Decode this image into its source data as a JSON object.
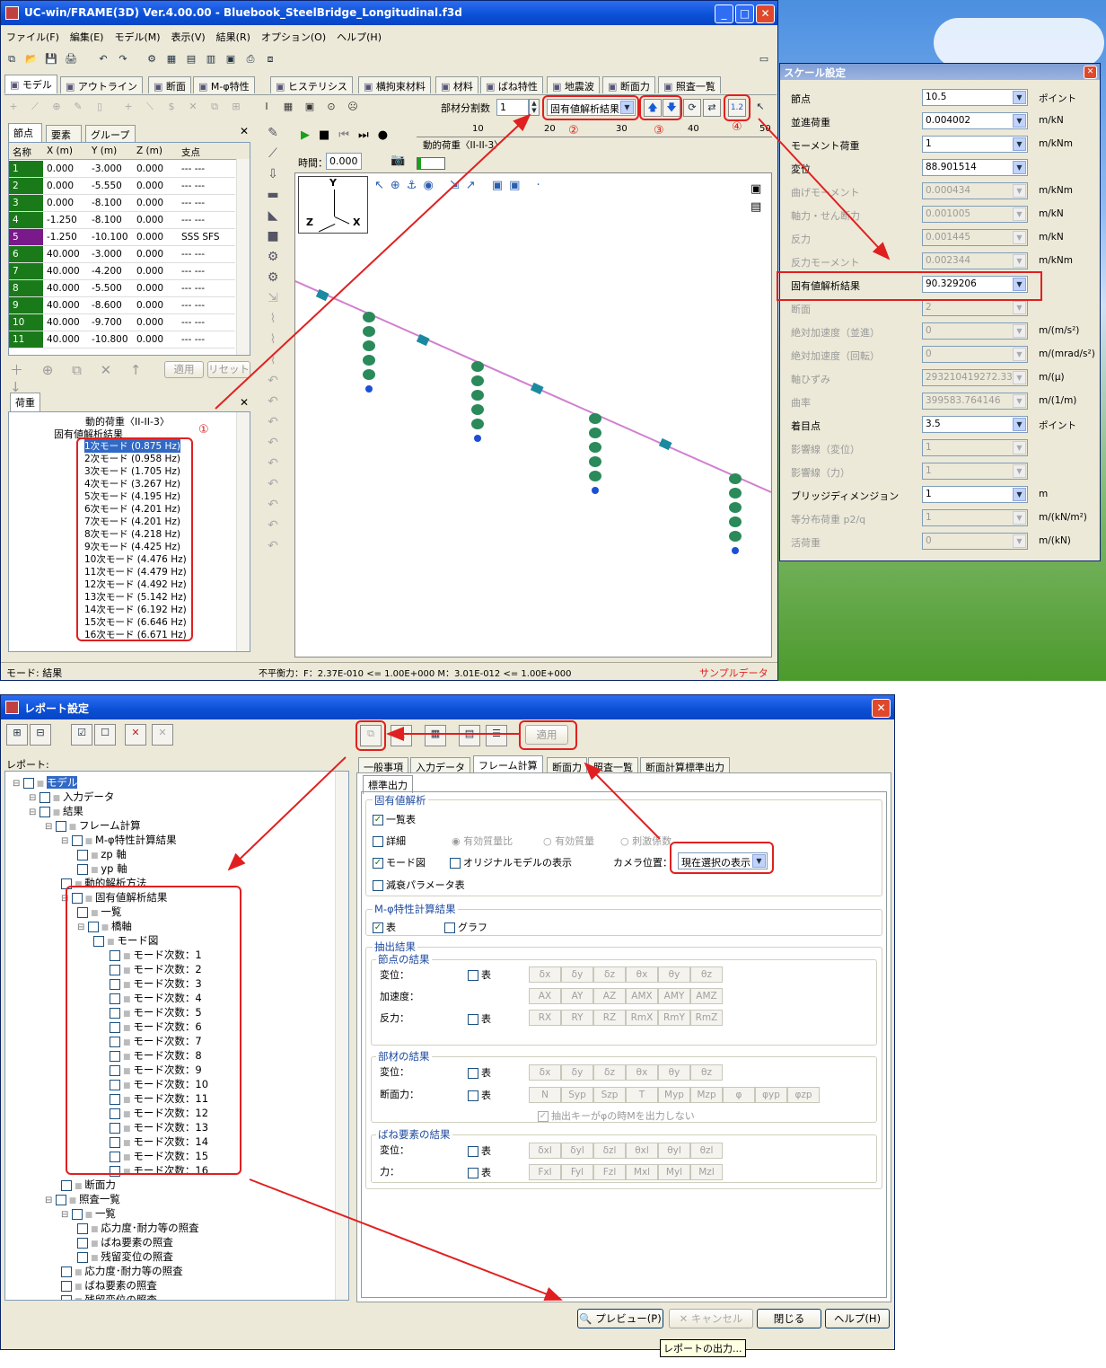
{
  "main_window": {
    "title": "UC-win/FRAME(3D) Ver.4.00.00 - Bluebook_SteelBridge_Longitudinal.f3d",
    "menu": [
      "ファイル(F)",
      "編集(E)",
      "モデル(M)",
      "表示(V)",
      "結果(R)",
      "オプション(O)",
      "ヘルプ(H)"
    ],
    "tabs": [
      "モデル",
      "アウトライン",
      "断面",
      "M-φ特性",
      "ヒステリシス",
      "横拘束材料",
      "材料",
      "ばね特性",
      "地震波",
      "断面力",
      "照査一覧"
    ],
    "segment_label": "部材分割数",
    "segment_value": "1",
    "result_combo": "固有値解析結果",
    "markers": [
      "①",
      "②",
      "③",
      "④"
    ],
    "ruler": [
      "10",
      "20",
      "30",
      "40",
      "50"
    ],
    "dynamic_load": "動的荷重〈II-II-3〉",
    "time_label": "時間：",
    "time_value": "0.000",
    "status": {
      "mode": "モード: 結果",
      "balance": "不平衡力：F：2.37E-010 <= 1.00E+000  M：3.01E-012 <= 1.00E+000",
      "sample": "サンプルデータ"
    }
  },
  "node_grid": {
    "tabs": [
      "節点",
      "要素",
      "グループ"
    ],
    "headers": [
      "名称",
      "X (m)",
      "Y (m)",
      "Z (m)",
      "支点"
    ],
    "rows": [
      [
        "1",
        "0.000",
        "-3.000",
        "0.000",
        "--- ---"
      ],
      [
        "2",
        "0.000",
        "-5.550",
        "0.000",
        "--- ---"
      ],
      [
        "3",
        "0.000",
        "-8.100",
        "0.000",
        "--- ---"
      ],
      [
        "4",
        "-1.250",
        "-8.100",
        "0.000",
        "--- ---"
      ],
      [
        "5",
        "-1.250",
        "-10.100",
        "0.000",
        "SSS SFS"
      ],
      [
        "6",
        "40.000",
        "-3.000",
        "0.000",
        "--- ---"
      ],
      [
        "7",
        "40.000",
        "-4.200",
        "0.000",
        "--- ---"
      ],
      [
        "8",
        "40.000",
        "-5.500",
        "0.000",
        "--- ---"
      ],
      [
        "9",
        "40.000",
        "-8.600",
        "0.000",
        "--- ---"
      ],
      [
        "10",
        "40.000",
        "-9.700",
        "0.000",
        "--- ---"
      ],
      [
        "11",
        "40.000",
        "-10.800",
        "0.000",
        "--- ---"
      ]
    ],
    "apply": "適用",
    "reset": "リセット"
  },
  "load_panel": {
    "tab": "荷重",
    "items": [
      "動的荷重〈II-II-3〉",
      "固有値解析結果"
    ],
    "modes": [
      "1次モード (0.875 Hz)",
      "2次モード (0.958 Hz)",
      "3次モード (1.705 Hz)",
      "4次モード (3.267 Hz)",
      "5次モード (4.195 Hz)",
      "6次モード (4.201 Hz)",
      "7次モード (4.201 Hz)",
      "8次モード (4.218 Hz)",
      "9次モード (4.425 Hz)",
      "10次モード (4.476 Hz)",
      "11次モード (4.479 Hz)",
      "12次モード (4.492 Hz)",
      "13次モード (5.142 Hz)",
      "14次モード (6.192 Hz)",
      "15次モード (6.646 Hz)",
      "16次モード (6.671 Hz)"
    ]
  },
  "scale_window": {
    "title": "スケール設定",
    "rows": [
      {
        "label": "節点",
        "value": "10.5",
        "unit": "ポイント",
        "enabled": true
      },
      {
        "label": "並進荷重",
        "value": "0.004002",
        "unit": "m/kN",
        "enabled": true
      },
      {
        "label": "モーメント荷重",
        "value": "1",
        "unit": "m/kNm",
        "enabled": true
      },
      {
        "label": "変位",
        "value": "88.901514",
        "unit": "",
        "enabled": true
      },
      {
        "label": "曲げモーメント",
        "value": "0.000434",
        "unit": "m/kNm",
        "enabled": false
      },
      {
        "label": "軸力・せん断力",
        "value": "0.001005",
        "unit": "m/kN",
        "enabled": false
      },
      {
        "label": "反力",
        "value": "0.001445",
        "unit": "m/kN",
        "enabled": false
      },
      {
        "label": "反力モーメント",
        "value": "0.002344",
        "unit": "m/kNm",
        "enabled": false
      },
      {
        "label": "固有値解析結果",
        "value": "90.329206",
        "unit": "",
        "enabled": true
      },
      {
        "label": "断面",
        "value": "2",
        "unit": "",
        "enabled": false
      },
      {
        "label": "絶対加速度（並進）",
        "value": "0",
        "unit": "m/(m/s²)",
        "enabled": false
      },
      {
        "label": "絶対加速度（回転）",
        "value": "0",
        "unit": "m/(mrad/s²)",
        "enabled": false
      },
      {
        "label": "軸ひずみ",
        "value": "293210419272.3317",
        "unit": "m/(μ)",
        "enabled": false
      },
      {
        "label": "曲率",
        "value": "399583.764146",
        "unit": "m/(1/m)",
        "enabled": false
      },
      {
        "label": "着目点",
        "value": "3.5",
        "unit": "ポイント",
        "enabled": true
      },
      {
        "label": "影響線（変位）",
        "value": "1",
        "unit": "",
        "enabled": false
      },
      {
        "label": "影響線（力）",
        "value": "1",
        "unit": "",
        "enabled": false
      },
      {
        "label": "ブリッジディメンジョン",
        "value": "1",
        "unit": "m",
        "enabled": true
      },
      {
        "label": "等分布荷重 p2/q",
        "value": "1",
        "unit": "m/(kN/m²)",
        "enabled": false
      },
      {
        "label": "活荷重",
        "value": "0",
        "unit": "m/(kN)",
        "enabled": false
      }
    ]
  },
  "report_window": {
    "title": "レポート設定",
    "report_label": "レポート:",
    "apply": "適用",
    "tabs": [
      "一般事項",
      "入力データ",
      "フレーム計算",
      "断面力",
      "照査一覧",
      "断面計算標準出力"
    ],
    "subtab": "標準出力",
    "tree": [
      "モデル",
      "入力データ",
      "結果",
      "フレーム計算",
      "M-φ特性計算結果",
      "zp 軸",
      "yp 軸",
      "動的解析方法",
      "固有値解析結果",
      "一覧",
      "橋軸",
      "モード図",
      "モード次数：1",
      "モード次数：2",
      "モード次数：3",
      "モード次数：4",
      "モード次数：5",
      "モード次数：6",
      "モード次数：7",
      "モード次数：8",
      "モード次数：9",
      "モード次数：10",
      "モード次数：11",
      "モード次数：12",
      "モード次数：13",
      "モード次数：14",
      "モード次数：15",
      "モード次数：16",
      "断面力",
      "照査一覧",
      "一覧",
      "応力度･耐力等の照査",
      "ばね要素の照査",
      "残留変位の照査",
      "応力度･耐力等の照査",
      "ばね要素の照査",
      "残留変位の照査"
    ],
    "eigen_group": "固有値解析",
    "list_table": "一覧表",
    "detail": "詳細",
    "eff_ratio": "有効質量比",
    "eff_mass": "有効質量",
    "stim": "刺激係数",
    "mode_fig": "モード図",
    "orig_model": "オリジナルモデルの表示",
    "camera": "カメラ位置：",
    "camera_value": "現在選択の表示",
    "damping": "減衰パラメータ表",
    "mphi_group": "M-φ特性計算結果",
    "table": "表",
    "graph": "グラフ",
    "extract_group": "抽出結果",
    "node_results": "節点の結果",
    "disp": "変位：",
    "accel": "加速度：",
    "react": "反力：",
    "disp_btns": [
      "δx",
      "δy",
      "δz",
      "θx",
      "θy",
      "θz"
    ],
    "accel_btns": [
      "AX",
      "AY",
      "AZ",
      "AMX",
      "AMY",
      "AMZ"
    ],
    "react_btns": [
      "RX",
      "RY",
      "RZ",
      "RmX",
      "RmY",
      "RmZ"
    ],
    "member_results": "部材の結果",
    "force": "断面力：",
    "force_btns": [
      "N",
      "Syp",
      "Szp",
      "T",
      "Myp",
      "Mzp",
      "φ",
      "φyp",
      "φzp"
    ],
    "no_output": "抽出キーがφの時Mを出力しない",
    "spring_results": "ばね要素の結果",
    "spring_force": "力：",
    "spring_disp_btns": [
      "δxl",
      "δyl",
      "δzl",
      "θxl",
      "θyl",
      "θzl"
    ],
    "spring_force_btns": [
      "Fxl",
      "Fyl",
      "Fzl",
      "Mxl",
      "Myl",
      "Mzl"
    ],
    "preview": "プレビュー(P)",
    "cancel": "キャンセル",
    "close": "閉じる",
    "help": "ヘルプ(H)",
    "tooltip": "レポートの出力..."
  },
  "colors": {
    "accent": "#e02020",
    "title_blue": "#0a4fd6",
    "node_green": "#1a7a1a",
    "node_purple": "#7a1a8a"
  }
}
